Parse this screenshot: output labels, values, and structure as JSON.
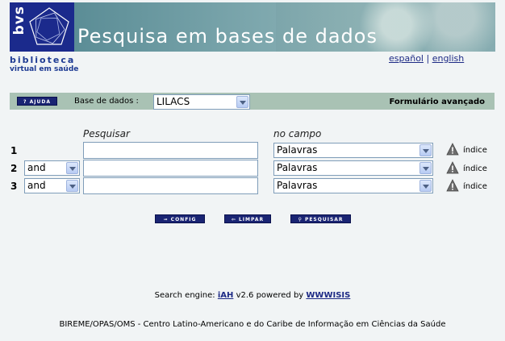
{
  "header": {
    "logo_text": "bvs",
    "banner_title": "Pesquisa em bases de dados",
    "brand_line1": "biblioteca",
    "brand_line2": "virtual em saúde",
    "lang_es": "español",
    "lang_sep": "|",
    "lang_en": "english"
  },
  "toolbar": {
    "help_label": "? AJUDA",
    "database_label": "Base de dados :",
    "database_value": "LILACS",
    "advanced_form": "Formulário avançado"
  },
  "form": {
    "col_search": "Pesquisar",
    "col_field": "no campo",
    "rows": [
      {
        "num": "1",
        "operator": "",
        "value": "",
        "field": "Palavras",
        "index": "índice"
      },
      {
        "num": "2",
        "operator": "and",
        "value": "",
        "field": "Palavras",
        "index": "índice"
      },
      {
        "num": "3",
        "operator": "and",
        "value": "",
        "field": "Palavras",
        "index": "índice"
      }
    ]
  },
  "actions": {
    "config": "CONFIG",
    "clear": "LIMPAR",
    "search": "PESQUISAR"
  },
  "footer": {
    "engine_prefix": "Search engine:",
    "engine_name": "iAH",
    "engine_mid": "v2.6 powered by",
    "engine_link": "WWWISIS",
    "credit": "BIREME/OPAS/OMS - Centro Latino-Americano e do Caribe de Informação em Ciências da Saúde"
  },
  "colors": {
    "logo_bg": "#1b2a8c",
    "toolbar_bg": "#a9c2b4",
    "button_bg": "#1a2473",
    "link": "#1d2a85",
    "page_bg": "#f1f4f5"
  },
  "icons": {
    "logo": "bvs-star-logo-icon",
    "warning": "warning-triangle-icon",
    "key": "key-icon",
    "clear": "back-arrow-icon",
    "search": "magnifier-icon"
  }
}
